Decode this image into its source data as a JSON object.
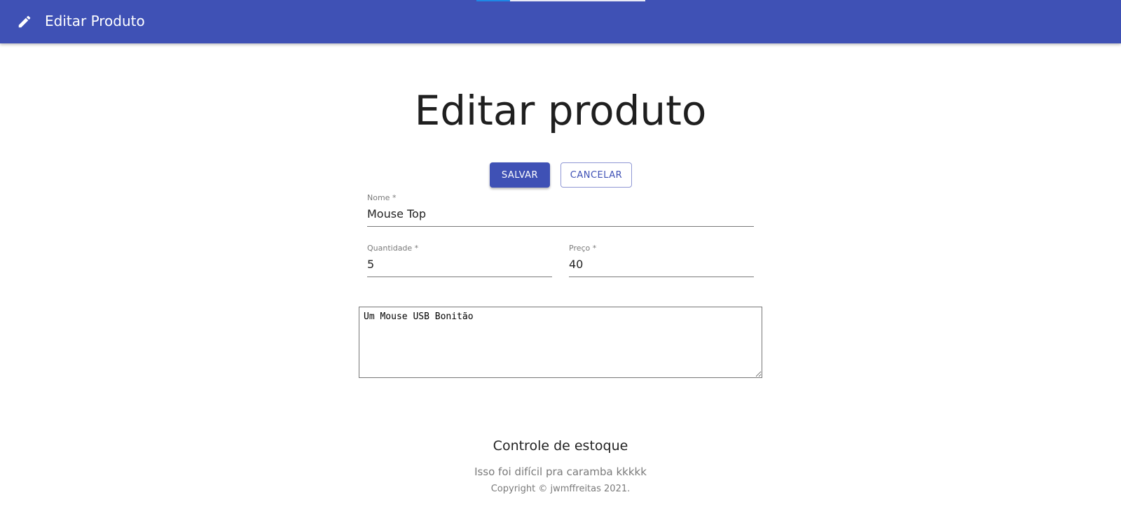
{
  "appbar": {
    "title": "Editar Produto",
    "icon": "pencil-icon",
    "color": "#3f51b5"
  },
  "page": {
    "title": "Editar produto"
  },
  "actions": {
    "save_label": "SALVAR",
    "cancel_label": "CANCELAR"
  },
  "form": {
    "name": {
      "label": "Nome *",
      "value": "Mouse Top"
    },
    "quantity": {
      "label": "Quantidade *",
      "value": "5"
    },
    "price": {
      "label": "Preço *",
      "value": "40"
    },
    "description": {
      "value": "Um Mouse USB Bonitão"
    }
  },
  "footer": {
    "title": "Controle de estoque",
    "subtitle": "Isso foi difícil pra caramba kkkkk",
    "copyright": "Copyright © jwmffreitas 2021."
  }
}
